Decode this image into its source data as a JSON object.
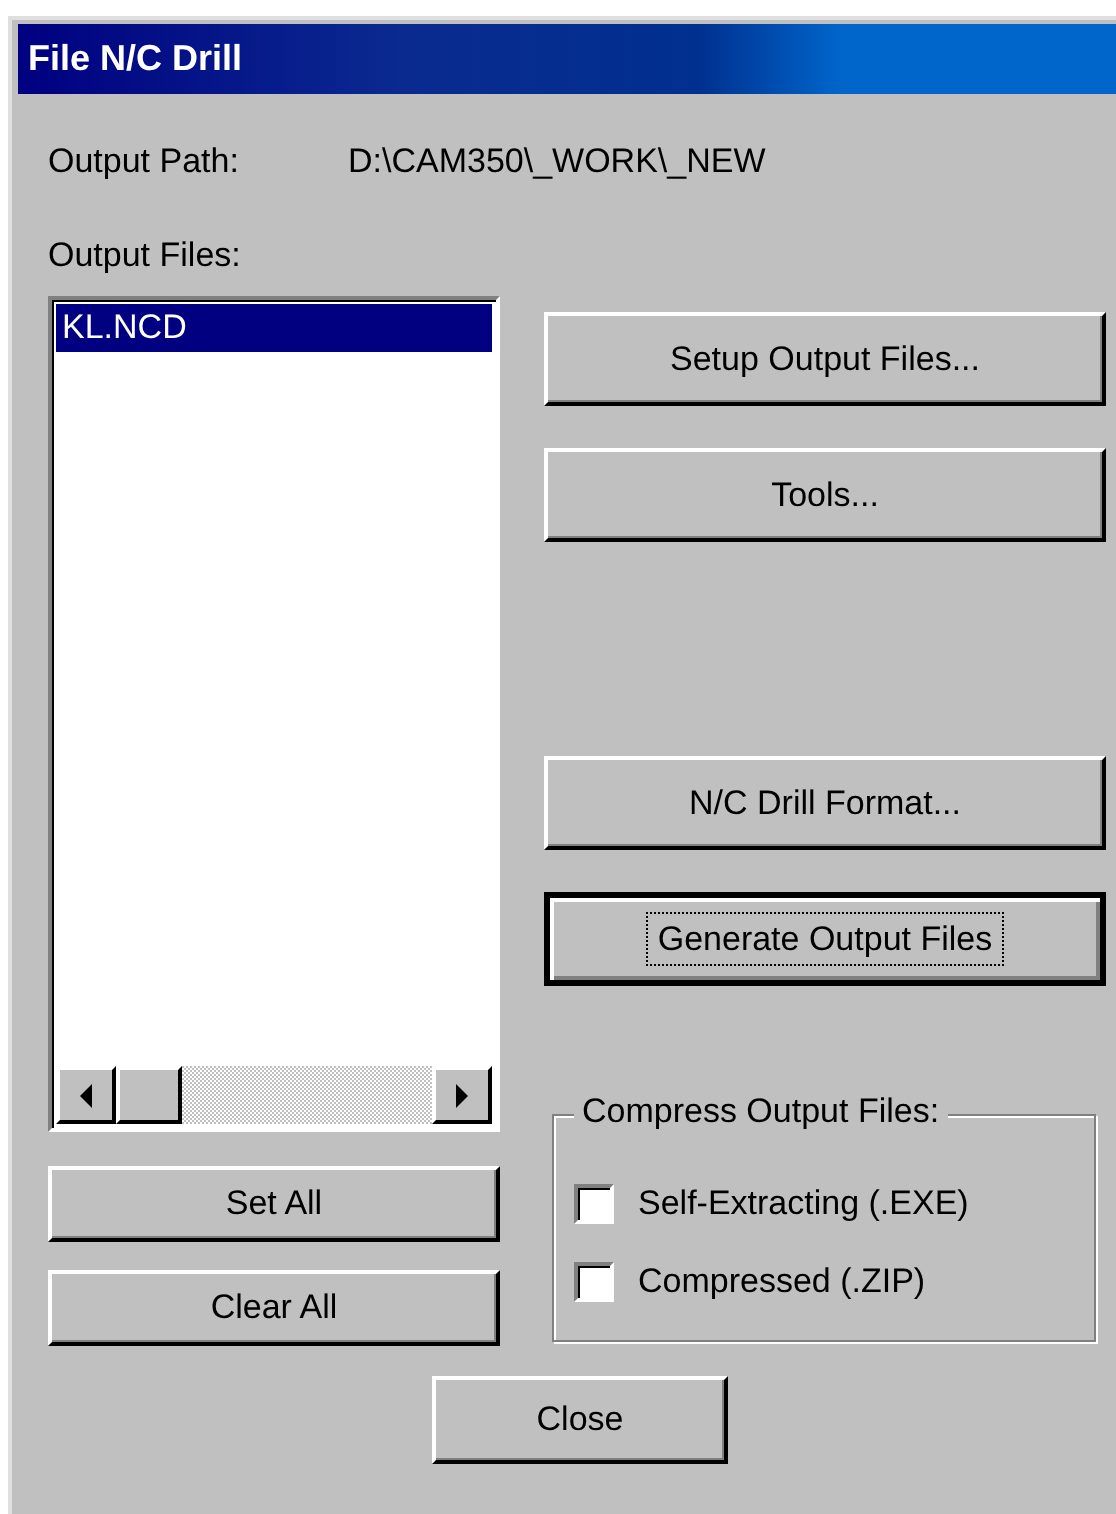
{
  "window": {
    "title": "File N/C Drill"
  },
  "output_path": {
    "label": "Output Path:",
    "value": "D:\\CAM350\\_WORK\\_NEW"
  },
  "output_files": {
    "label": "Output Files:",
    "items": [
      {
        "name": "KL.NCD",
        "selected": true
      }
    ]
  },
  "right_buttons": [
    {
      "label": "Setup Output Files...",
      "default": false
    },
    {
      "label": "Tools...",
      "default": false
    },
    {
      "label": "N/C Drill Format...",
      "default": false
    },
    {
      "label": "Generate Output Files",
      "default": true
    }
  ],
  "list_buttons": [
    "Set All",
    "Clear All"
  ],
  "compress": {
    "label": "Compress Output Files:",
    "options": [
      {
        "label": "Self-Extracting (.EXE)",
        "checked": false
      },
      {
        "label": "Compressed (.ZIP)",
        "checked": false
      }
    ]
  },
  "close_button": "Close"
}
